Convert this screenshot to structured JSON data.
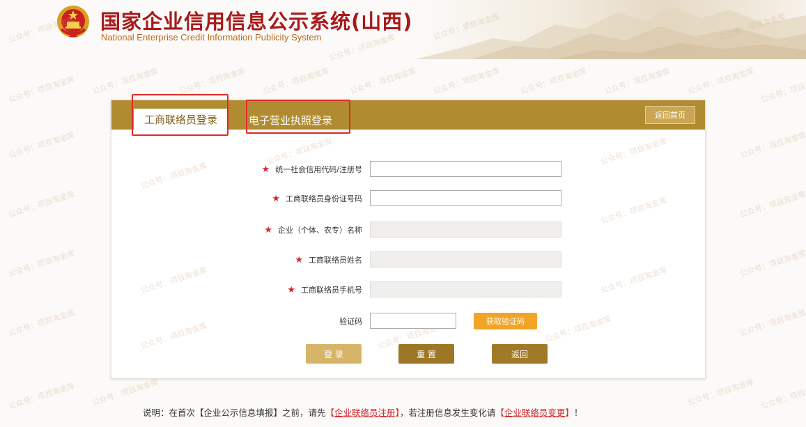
{
  "header": {
    "title": "国家企业信用信息公示系统(山西)",
    "subtitle": "National Enterprise Credit Information Publicity System"
  },
  "watermark": "公众号：项目淘金库",
  "tabs": {
    "active": "工商联络员登录",
    "inactive": "电子营业执照登录",
    "back_home": "返回首页"
  },
  "form": {
    "fields": [
      {
        "label": "统一社会信用代码/注册号",
        "required": true,
        "value": "",
        "readonly": false
      },
      {
        "label": "工商联络员身份证号码",
        "required": true,
        "value": "",
        "readonly": false
      },
      {
        "label": "企业（个体、农专）名称",
        "required": true,
        "value": "",
        "readonly": true
      },
      {
        "label": "工商联络员姓名",
        "required": true,
        "value": "",
        "readonly": true
      },
      {
        "label": "工商联络员手机号",
        "required": true,
        "value": "",
        "readonly": true
      }
    ],
    "required_mark": "★",
    "captcha_label": "验证码",
    "captcha_value": "",
    "get_code_button": "获取验证码",
    "login_button": "登 录",
    "reset_button": "重 置",
    "return_button": "返回"
  },
  "note": {
    "prefix": "说明：在首次【企业公示信息填报】之前，请先",
    "link1": "企业联络员注册",
    "middle": "，若注册信息发生变化请",
    "link2": "企业联络员变更",
    "suffix": "！",
    "bracket_open": "【",
    "bracket_close": "】"
  },
  "colors": {
    "brand_red": "#a8191b",
    "tab_bar": "#b18b2f",
    "highlight_box": "#e02a2a",
    "get_code": "#f2a425"
  }
}
